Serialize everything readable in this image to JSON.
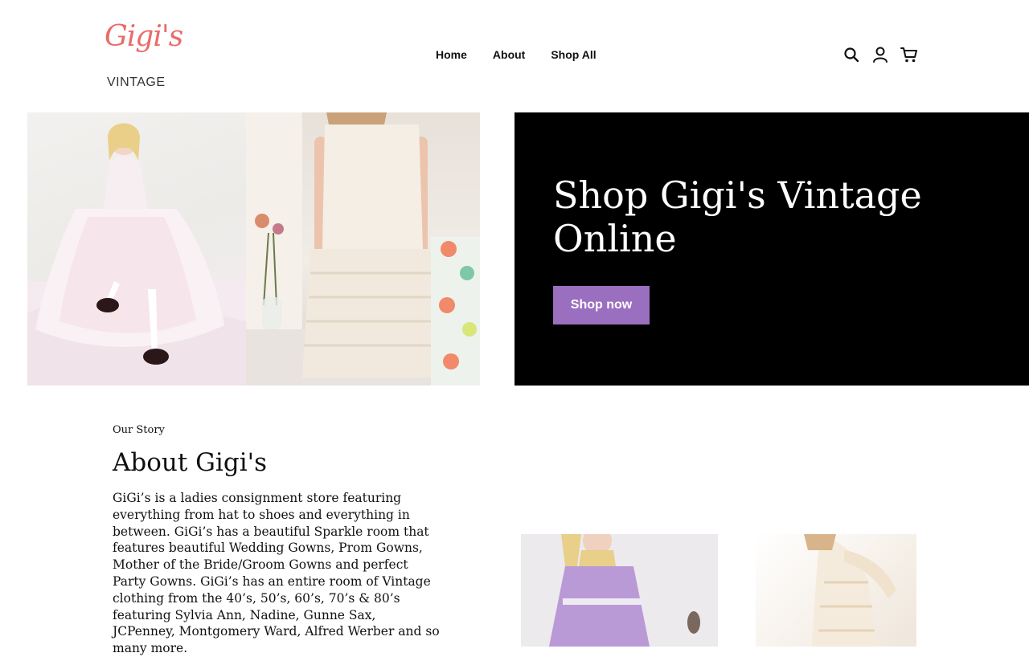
{
  "brand": {
    "script_name": "Gigi's",
    "subtitle": "VINTAGE",
    "accent_color": "#ea6b6b"
  },
  "nav": {
    "items": [
      {
        "label": "Home"
      },
      {
        "label": "About"
      },
      {
        "label": "Shop All"
      }
    ]
  },
  "header_icons": [
    "search-icon",
    "account-icon",
    "cart-icon"
  ],
  "hero": {
    "title": "Shop Gigi's Vintage Online",
    "button_label": "Shop now",
    "button_color": "#9b6fbf",
    "banner_color": "#000000"
  },
  "about": {
    "kicker": "Our Story",
    "title": "About Gigi's",
    "body": "GiGi’s is a ladies consignment store featuring everything from hat to shoes and everything in between. GiGi’s has a beautiful Sparkle room that features beautiful Wedding Gowns, Prom Gowns, Mother of the Bride/Groom Gowns and perfect Party Gowns. GiGi’s has an entire room of Vintage clothing from the 40’s, 50’s, 60’s, 70’s & 80’s featuring Sylvia Ann, Nadine, Gunne Sax, JCPenney, Montgomery Ward, Alfred Werber and so many more."
  }
}
